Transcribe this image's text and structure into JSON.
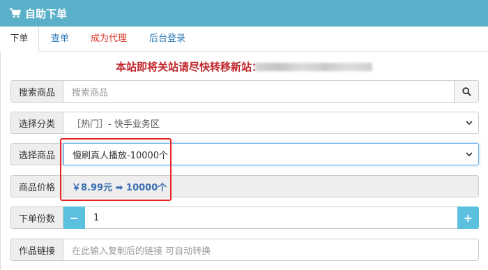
{
  "header": {
    "title": "自助下单",
    "icon": "cart-icon"
  },
  "tabs": [
    {
      "label": "下单"
    },
    {
      "label": "查单"
    },
    {
      "label": "成为代理"
    },
    {
      "label": "后台登录"
    }
  ],
  "notice": {
    "text": "本站即将关站请尽快转移新站："
  },
  "form": {
    "search": {
      "label": "搜索商品",
      "placeholder": "搜索商品"
    },
    "category": {
      "label": "选择分类",
      "value": "［热门］- 快手业务区"
    },
    "product": {
      "label": "选择商品",
      "value": "慢刷真人播放-10000个"
    },
    "price": {
      "label": "商品价格",
      "value": "￥8.99元 ➡ 10000个"
    },
    "quantity": {
      "label": "下单份数",
      "value": "1",
      "minus": "−",
      "plus": "+"
    },
    "link": {
      "label": "作品链接",
      "placeholder": "在此输入复制后的链接 可自动转换"
    }
  },
  "colors": {
    "header": "#5bb0c9",
    "notice": "#c0262a",
    "step_button": "#5bc0de",
    "highlight": "#e8231f"
  }
}
